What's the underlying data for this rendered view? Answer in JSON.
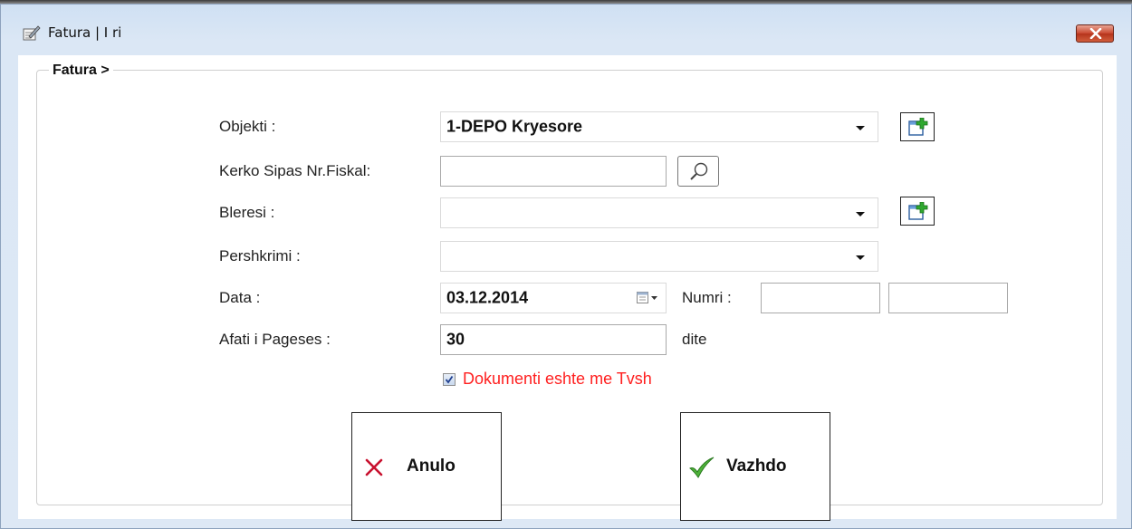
{
  "window": {
    "title": "Fatura | I ri"
  },
  "group": {
    "title": "Fatura >"
  },
  "form": {
    "objekti": {
      "label": "Objekti :",
      "value": "1-DEPO Kryesore"
    },
    "kerko": {
      "label": "Kerko Sipas Nr.Fiskal:",
      "value": ""
    },
    "bleresi": {
      "label": "Bleresi :",
      "value": ""
    },
    "pershkrimi": {
      "label": "Pershkrimi :",
      "value": ""
    },
    "data": {
      "label": "Data :",
      "value": "03.12.2014"
    },
    "numri": {
      "label": "Numri :",
      "value1": "",
      "value2": ""
    },
    "afati": {
      "label": "Afati i Pageses :",
      "value": "30",
      "unit": "dite"
    },
    "tvsh": {
      "label": "Dokumenti eshte me Tvsh",
      "checked": true
    }
  },
  "buttons": {
    "anulo": "Anulo",
    "vazhdo": "Vazhdo"
  },
  "icons": {
    "app": "edit-document-icon",
    "close": "close-icon",
    "add": "add-new-icon",
    "search": "magnifier-icon",
    "calendar": "calendar-icon",
    "cancel": "x-icon",
    "confirm": "checkmark-icon"
  },
  "colors": {
    "tvsh_label": "#ff1f1f",
    "cancel_icon": "#c8102e",
    "confirm_icon": "#3a9a2a",
    "close_button": "#c9472e"
  }
}
